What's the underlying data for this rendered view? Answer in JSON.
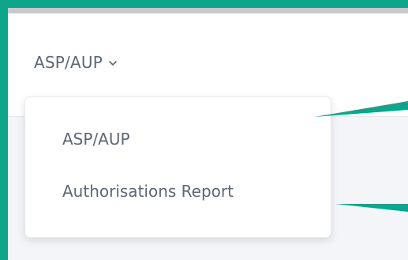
{
  "nav": {
    "trigger_label": "ASP/AUP",
    "trigger_icon": "chevron-down-icon"
  },
  "dropdown": {
    "items": [
      {
        "label": "ASP/AUP"
      },
      {
        "label": "Authorisations Report"
      }
    ]
  },
  "colors": {
    "frame": "#0ea58a",
    "text": "#5d6675",
    "background": "#f4f5f8"
  }
}
